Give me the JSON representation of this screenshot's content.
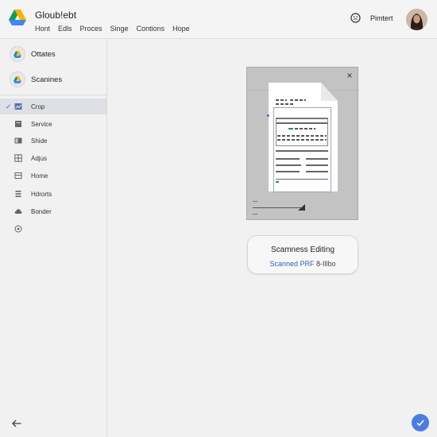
{
  "app": {
    "title": "Gloub!ebt",
    "menu": [
      "Hont",
      "Edls",
      "Proces",
      "Singe",
      "Contions",
      "Hope"
    ],
    "account_label": "Pimtert"
  },
  "sidebar": {
    "drives": [
      {
        "label": "Ottates",
        "icon": "drive-icon"
      },
      {
        "label": "Scanines",
        "icon": "drive-icon"
      }
    ],
    "items": [
      {
        "label": "Crop",
        "icon": "crop-icon",
        "active": true
      },
      {
        "label": "Service",
        "icon": "service-icon",
        "active": false
      },
      {
        "label": "Shide",
        "icon": "slide-icon",
        "active": false
      },
      {
        "label": "Adjus",
        "icon": "adjust-icon",
        "active": false
      },
      {
        "label": "Home",
        "icon": "home-icon",
        "active": false
      },
      {
        "label": "Hdrorts",
        "icon": "list-icon",
        "active": false
      },
      {
        "label": "Bonder",
        "icon": "cloud-icon",
        "active": false
      },
      {
        "label": "",
        "icon": "settings-icon",
        "active": false
      }
    ],
    "active_check": "✓"
  },
  "preview": {
    "close_glyph": "×"
  },
  "status": {
    "title": "Scamness Editing",
    "subtitle_blue": "Scanned PRF",
    "subtitle_gray": " 8-Illbo"
  },
  "colors": {
    "accent": "#4a7de0",
    "link": "#2f5fc4",
    "active_bg": "#dfe0e6"
  }
}
